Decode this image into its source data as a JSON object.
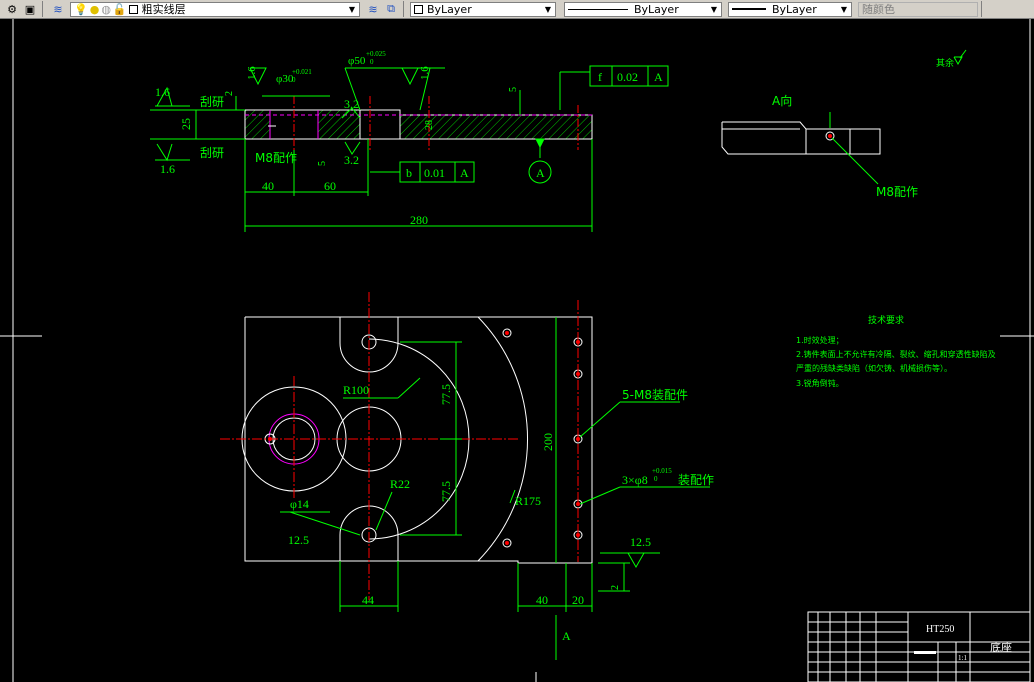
{
  "toolbar": {
    "layer_name": "粗实线层",
    "color_value": "ByLayer",
    "linetype_value": "ByLayer",
    "lineweight_value": "ByLayer",
    "plotstyle_value": "随颜色"
  },
  "drawing": {
    "section": {
      "ra_left_top": "1.6",
      "grind_top": "刮研",
      "ra_left_bottom": "1.6",
      "grind_bottom": "刮研",
      "dim_25": "25",
      "dim_2": "2",
      "ra_top_1": "1.6",
      "phi30": "φ30",
      "phi30_tol_upper": "+0.021",
      "phi30_tol_lower": "0",
      "phi50": "φ50",
      "phi50_tol_upper": "+0.025",
      "phi50_tol_lower": "0",
      "ra_top_2": "1.6",
      "ra_mid_top": "3.2",
      "ra_mid_bottom": "3.2",
      "m8_label": "M8配作",
      "dim_5_small": "5",
      "dim_5_right": "5",
      "dim_28": "28",
      "dim_40": "40",
      "dim_60": "60",
      "dim_280": "280",
      "flatness_symbol": "f",
      "flatness_value": "0.02",
      "flatness_datum": "A",
      "parallel_symbol": "b",
      "parallel_value": "0.01",
      "parallel_datum": "A",
      "datum_label": "A"
    },
    "view_a": {
      "title": "A向",
      "m8_label": "M8配作"
    },
    "top_right_note": "其余",
    "plan": {
      "r100": "R100",
      "dim_77_5_top": "77.5",
      "dim_77_5_bottom": "77.5",
      "r22": "R22",
      "phi14": "φ14",
      "ra_12_5_left": "12.5",
      "dim_200": "200",
      "r175": "R175",
      "holes_5m8": "5-M8装配件",
      "holes_3phi8": "3×φ8",
      "holes_3phi8_tol_upper": "+0.015",
      "holes_3phi8_tol_lower": "0",
      "holes_3phi8_suffix": "装配作",
      "ra_12_5_right": "12.5",
      "dim_2_right": "2",
      "dim_44": "44",
      "dim_40": "40",
      "dim_20": "20",
      "datum_a": "A"
    },
    "tech_req": {
      "title": "技术要求",
      "lines": [
        "1.时效处理；",
        "2.铸件表面上不允许有冷隔、裂纹、缩孔和穿透性缺陷及",
        "严重的残缺类缺陷（如欠铸、机械损伤等）。",
        "3.锐角倒钝。"
      ]
    },
    "title_block": {
      "material": "HT250",
      "part_name": "底座",
      "scale": "1:1"
    }
  },
  "colors": {
    "background": "#000000",
    "green": "#00ff00",
    "white": "#ffffff",
    "red": "#ff0000",
    "magenta": "#ff00ff",
    "toolbar": "#d4d0c8"
  }
}
